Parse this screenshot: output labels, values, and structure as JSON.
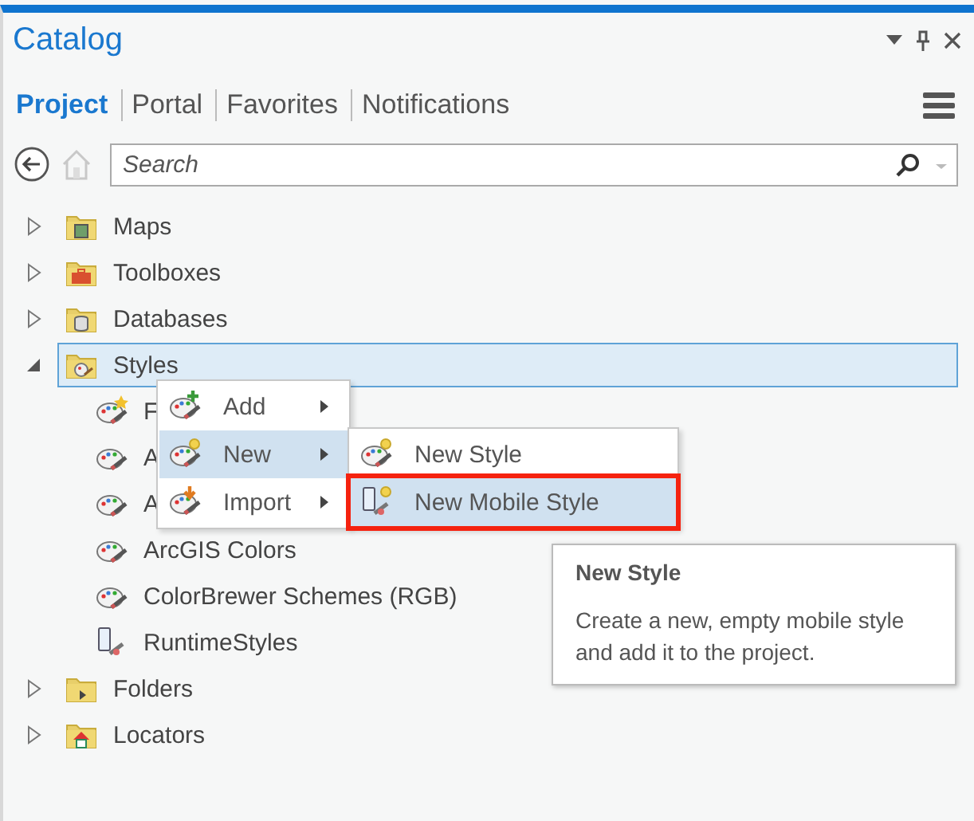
{
  "panel": {
    "title": "Catalog",
    "tabs": [
      {
        "label": "Project",
        "selected": true
      },
      {
        "label": "Portal",
        "selected": false
      },
      {
        "label": "Favorites",
        "selected": false
      },
      {
        "label": "Notifications",
        "selected": false
      }
    ]
  },
  "search": {
    "placeholder": "Search"
  },
  "tree": [
    {
      "label": "Maps",
      "kind": "maps",
      "expanded": false,
      "selected": false
    },
    {
      "label": "Toolboxes",
      "kind": "toolboxes",
      "expanded": false,
      "selected": false
    },
    {
      "label": "Databases",
      "kind": "databases",
      "expanded": false,
      "selected": false
    },
    {
      "label": "Styles",
      "kind": "styles",
      "expanded": true,
      "selected": true,
      "children": [
        {
          "label": "F",
          "kind": "favorite-style"
        },
        {
          "label": "A",
          "kind": "style"
        },
        {
          "label": "A",
          "kind": "style"
        },
        {
          "label": "ArcGIS Colors",
          "kind": "style"
        },
        {
          "label": "ColorBrewer Schemes (RGB)",
          "kind": "style"
        },
        {
          "label": "RuntimeStyles",
          "kind": "mobile-style"
        }
      ]
    },
    {
      "label": "Folders",
      "kind": "folders",
      "expanded": false,
      "selected": false
    },
    {
      "label": "Locators",
      "kind": "locators",
      "expanded": false,
      "selected": false
    }
  ],
  "context_menu": {
    "items": [
      {
        "label": "Add",
        "kind": "add",
        "selected": false
      },
      {
        "label": "New",
        "kind": "new",
        "selected": true
      },
      {
        "label": "Import",
        "kind": "import",
        "selected": false
      }
    ]
  },
  "submenu": {
    "items": [
      {
        "label": "New Style",
        "kind": "style",
        "selected": false,
        "annotated": false
      },
      {
        "label": "New Mobile Style",
        "kind": "mobile-style",
        "selected": true,
        "annotated": true
      }
    ]
  },
  "tooltip": {
    "title": "New Style",
    "text": "Create a new, empty mobile style and add it to the project."
  }
}
